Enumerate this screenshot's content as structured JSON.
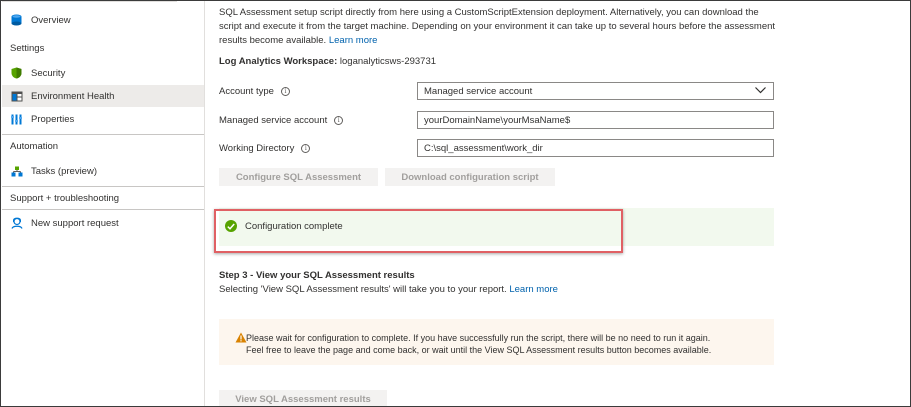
{
  "sidebar": {
    "items": [
      {
        "label": "Overview",
        "icon": "sql-server-icon"
      },
      {
        "label": "Security",
        "icon": "shield-icon"
      },
      {
        "label": "Environment Health",
        "icon": "environment-health-icon"
      },
      {
        "label": "Properties",
        "icon": "properties-icon"
      },
      {
        "label": "Tasks (preview)",
        "icon": "tasks-icon"
      },
      {
        "label": "New support request",
        "icon": "support-person-icon"
      }
    ],
    "sections": {
      "settings": "Settings",
      "automation": "Automation",
      "support": "Support + troubleshooting"
    },
    "selected": "Environment Health"
  },
  "main": {
    "intro_text": "SQL Assessment setup script directly from here using a CustomScriptExtension deployment. Alternatively, you can download the script and execute it from the target machine. Depending on your environment it can take up to several hours before the assessment results become available. ",
    "intro_link": "Learn more",
    "workspace_label": "Log Analytics Workspace:",
    "workspace_value": " loganalyticsws-293731",
    "form": {
      "account_type_label": "Account type",
      "account_type_value": "Managed service account",
      "msa_label": "Managed service account",
      "msa_value": "yourDomainName\\yourMsaName$",
      "workdir_label": "Working Directory",
      "workdir_value": "C:\\sql_assessment\\work_dir"
    },
    "buttons": {
      "configure": "Configure SQL Assessment",
      "download": "Download configuration script",
      "view_results": "View SQL Assessment results"
    },
    "status_text": "Configuration complete",
    "step3": {
      "title": "Step 3 - View your SQL Assessment results",
      "description": "Selecting 'View SQL Assessment results' will take you to your report. ",
      "link": "Learn more"
    },
    "warning": {
      "line1": "Please wait for configuration to complete. If you have successfully run the script, there will be no need to run it again.",
      "line2": "Feel free to leave the page and come back, or wait until the View SQL Assessment results button becomes available."
    }
  },
  "colors": {
    "accent_link": "#0062ad",
    "success": "#57a300",
    "highlight_border": "#e06064",
    "warning": "#d98200"
  }
}
